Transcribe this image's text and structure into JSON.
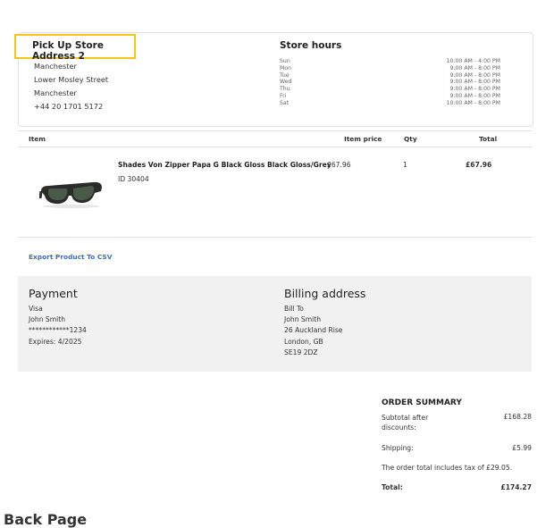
{
  "store": {
    "title": "Pick Up Store Address 2",
    "address_lines": [
      "Manchester",
      "Lower Mosley Street",
      "Manchester",
      "+44 20 1701 5172"
    ],
    "hours_title": "Store hours",
    "hours": [
      {
        "day": "Sun",
        "time": "10:00 AM - 4:00 PM"
      },
      {
        "day": "Mon",
        "time": "9:00 AM - 8:00 PM"
      },
      {
        "day": "Tue",
        "time": "9:00 AM - 8:00 PM"
      },
      {
        "day": "Wed",
        "time": "9:00 AM - 8:00 PM"
      },
      {
        "day": "Thu",
        "time": "9:00 AM - 8:00 PM"
      },
      {
        "day": "Fri",
        "time": "9:00 AM - 8:00 PM"
      },
      {
        "day": "Sat",
        "time": "10:00 AM - 8:00 PM"
      }
    ]
  },
  "table": {
    "headers": {
      "item": "Item",
      "price": "Item price",
      "qty": "Qty",
      "total": "Total"
    },
    "rows": [
      {
        "name": "Shades Von Zipper Papa G Black Gloss Black Gloss/Grey",
        "id": "ID 30404",
        "price": "£67.96",
        "qty": "1",
        "total": "£67.96"
      }
    ]
  },
  "export_label": "Export Product To CSV",
  "payment": {
    "title": "Payment",
    "lines": [
      "Visa",
      "John Smith",
      "************1234",
      "Expires: 4/2025"
    ]
  },
  "billing": {
    "title": "Billing address",
    "lines": [
      "Bill To",
      "John Smith",
      "26 Auckland Rise",
      "London, GB",
      "SE19 2DZ"
    ]
  },
  "summary": {
    "title": "ORDER SUMMARY",
    "subtotal_label_1": "Subtotal after",
    "subtotal_label_2": "discounts:",
    "subtotal_value": "£168.28",
    "shipping_label": "Shipping:",
    "shipping_value": "£5.99",
    "tax_note": "The order total includes tax of £29.05.",
    "total_label": "Total:",
    "total_value": "£174.27"
  },
  "footer_heading": "Back Page",
  "colors": {
    "highlight": "#f5c518",
    "link": "#3d6fb8",
    "panel": "#f1f1f1"
  }
}
